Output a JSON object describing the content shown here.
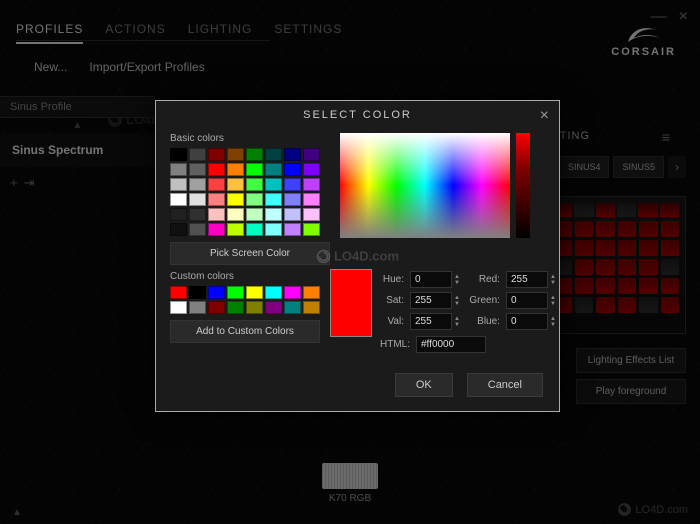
{
  "nav": {
    "tabs": [
      "PROFILES",
      "ACTIONS",
      "LIGHTING",
      "SETTINGS"
    ],
    "active": 0
  },
  "brand": "CORSAIR",
  "subnav": {
    "new": "New...",
    "import": "Import/Export Profiles"
  },
  "left": {
    "header": "Sinus Profile",
    "item": "Sinus Spectrum"
  },
  "right": {
    "title": "TING",
    "tabs": [
      "SINUS4",
      "SINUS5"
    ],
    "btn1": "Lighting Effects List",
    "btn2": "Play foreground"
  },
  "device": "K70 RGB",
  "wm": "LO4D.com",
  "modal": {
    "title": "SELECT COLOR",
    "basic_label": "Basic colors",
    "basic_colors": [
      "#000000",
      "#404040",
      "#800000",
      "#804000",
      "#008000",
      "#004040",
      "#000080",
      "#400080",
      "#808080",
      "#606060",
      "#ff0000",
      "#ff8000",
      "#00ff00",
      "#008080",
      "#0000ff",
      "#8000ff",
      "#c0c0c0",
      "#a0a0a0",
      "#ff4040",
      "#ffc040",
      "#40ff40",
      "#00c0c0",
      "#4040ff",
      "#c040ff",
      "#ffffff",
      "#e0e0e0",
      "#ff8080",
      "#ffff00",
      "#80ff80",
      "#40ffff",
      "#8080ff",
      "#ff80ff",
      "#202020",
      "#303030",
      "#ffc0c0",
      "#ffffc0",
      "#c0ffc0",
      "#c0ffff",
      "#c0c0ff",
      "#ffc0ff",
      "#101010",
      "#505050",
      "#ff00c0",
      "#c0ff00",
      "#00ffc0",
      "#80ffff",
      "#c080ff",
      "#80ff00"
    ],
    "pick_btn": "Pick Screen Color",
    "custom_label": "Custom colors",
    "custom_colors": [
      "#ff0000",
      "#000000",
      "#0000ff",
      "#00ff00",
      "#ffff00",
      "#00ffff",
      "#ff00ff",
      "#ff8000",
      "#ffffff",
      "#808080",
      "#800000",
      "#008000",
      "#808000",
      "#800080",
      "#008080",
      "#c08000"
    ],
    "addcustom": "Add to Custom Colors",
    "hue_l": "Hue:",
    "hue_v": "0",
    "sat_l": "Sat:",
    "sat_v": "255",
    "val_l": "Val:",
    "val_v": "255",
    "red_l": "Red:",
    "red_v": "255",
    "green_l": "Green:",
    "green_v": "0",
    "blue_l": "Blue:",
    "blue_v": "0",
    "html_l": "HTML:",
    "html_v": "#ff0000",
    "ok": "OK",
    "cancel": "Cancel"
  }
}
